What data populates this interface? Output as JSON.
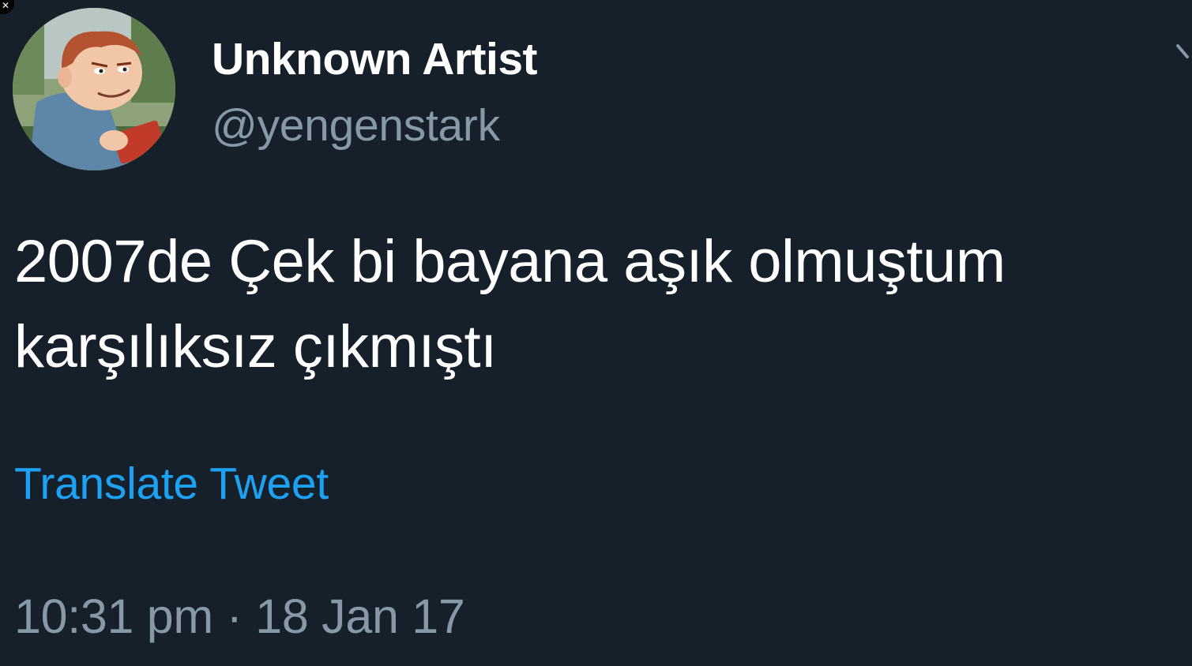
{
  "tweet": {
    "display_name": "Unknown Artist",
    "handle": "@yengenstark",
    "text_line1": "2007de Çek bi bayana aşık olmuştum",
    "text_line2": "karşılıksız çıkmıştı",
    "translate_label": "Translate Tweet",
    "timestamp": "10:31 pm · 18 Jan 17"
  },
  "icons": {
    "close": "close-icon",
    "more": "chevron-down-icon"
  },
  "colors": {
    "background": "#15202b",
    "primary_text": "#ffffff",
    "secondary_text": "#8899a6",
    "link": "#1da1f2"
  }
}
